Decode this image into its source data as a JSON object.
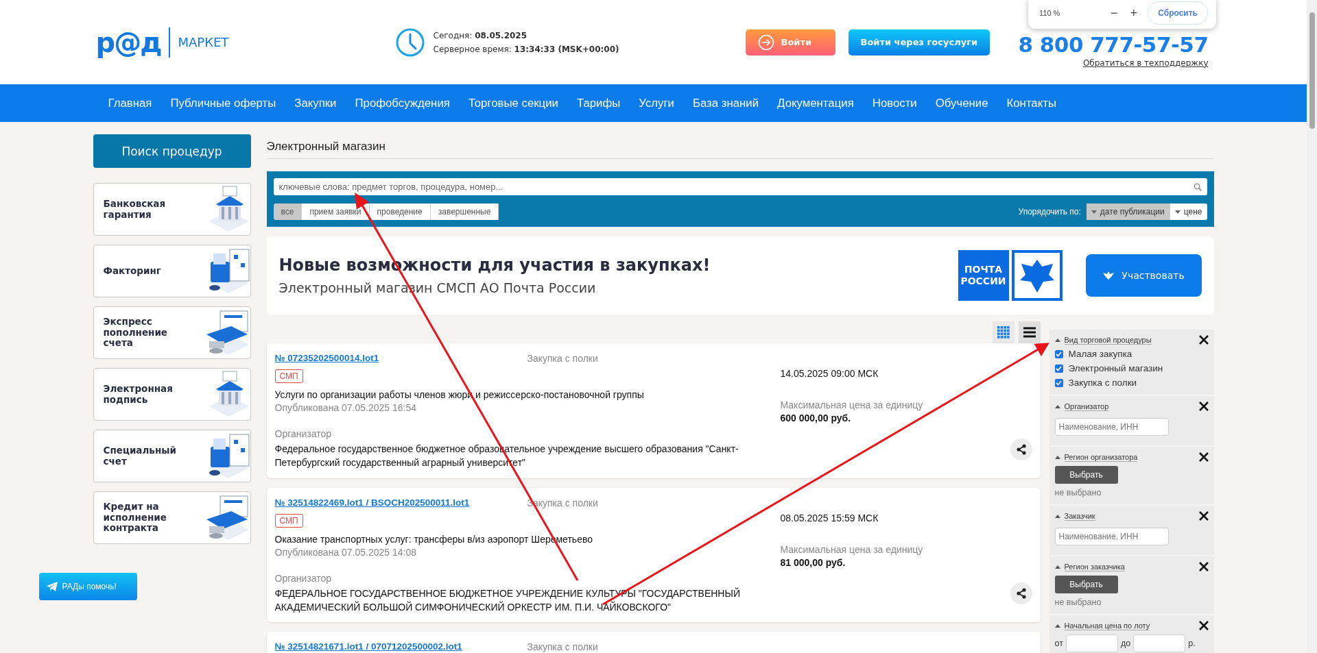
{
  "header": {
    "logo": {
      "mark": "р@д",
      "text": "МАРКЕТ"
    },
    "today_label": "Сегодня:",
    "today_value": "08.05.2025",
    "server_label": "Серверное время:",
    "server_value": "13:34:33 (MSK+00:00)",
    "login_button": "Войти",
    "gosuslugi_button": "Войти через госуслуги",
    "phone": "8 800 777-57-57",
    "support_link": "Обратиться в техподдержку"
  },
  "zoom_popup": {
    "level": "110 %",
    "minus": "−",
    "plus": "+",
    "reset": "Сбросить"
  },
  "nav": [
    "Главная",
    "Публичные оферты",
    "Закупки",
    "Профобсуждения",
    "Торговые секции",
    "Тарифы",
    "Услуги",
    "База знаний",
    "Документация",
    "Новости",
    "Обучение",
    "Контакты"
  ],
  "sidebar": {
    "search_button": "Поиск процедур",
    "services": [
      "Банковская гарантия",
      "Факторинг",
      "Экспресс пополнение счета",
      "Электронная подпись",
      "Специальный счет",
      "Кредит на исполнение контракта"
    ],
    "help_button": "РАДы помочь!"
  },
  "page_title": "Электронный магазин",
  "search": {
    "placeholder": "ключевые слова: предмет торгов, процедура, номер...",
    "tabs": [
      {
        "label": "все",
        "selected": true
      },
      {
        "label": "прием заявки",
        "selected": false
      },
      {
        "label": "проведение",
        "selected": false
      },
      {
        "label": "завершенные",
        "selected": false
      }
    ],
    "sort_label": "Упорядочить по:",
    "sort": [
      {
        "label": "дате публикации",
        "selected": true
      },
      {
        "label": "цене",
        "selected": false
      }
    ]
  },
  "banner": {
    "title": "Новые возможности для участия в закупках!",
    "subtitle": "Электронный магазин СМСП АО Почта России",
    "logo_text": [
      "ПОЧТА",
      "РОССИИ"
    ],
    "button": "Участвовать"
  },
  "view_toggle": [
    {
      "kind": "grid",
      "selected": false
    },
    {
      "kind": "list",
      "selected": true
    }
  ],
  "lots": [
    {
      "number": "№ 07235202500014.lot1",
      "type": "Закупка с полки",
      "badge": "СМП",
      "title": "Услуги по организации работы членов жюри и режиссерско-постановочной группы",
      "published": "Опубликована 07.05.2025 16:54",
      "organizer_label": "Организатор",
      "organizer": "Федеральное государственное бюджетное образовательное учреждение высшего образования \"Санкт-Петербургский государственный аграрный университет\"",
      "deadline": "14.05.2025 09:00 МСК",
      "price_label": "Максимальная цена за единицу",
      "price": "600 000,00 руб."
    },
    {
      "number": "№ 32514822469.lot1 / BSOCH202500011.lot1",
      "type": "Закупка с полки",
      "badge": "СМП",
      "title": "Оказание транспортных услуг: трансферы в/из аэропорт Шереметьево",
      "published": "Опубликована 07.05.2025 14:08",
      "organizer_label": "Организатор",
      "organizer": "ФЕДЕРАЛЬНОЕ ГОСУДАРСТВЕННОЕ БЮДЖЕТНОЕ УЧРЕЖДЕНИЕ КУЛЬТУРЫ \"ГОСУДАРСТВЕННЫЙ АКАДЕМИЧЕСКИЙ БОЛЬШОЙ СИМФОНИЧЕСКИЙ ОРКЕСТР ИМ. П.И. ЧАЙКОВСКОГО\"",
      "deadline": "08.05.2025 15:59 МСК",
      "price_label": "Максимальная цена за единицу",
      "price": "81 000,00 руб."
    },
    {
      "number": "№ 32514821671.lot1 / 07071202500002.lot1",
      "type": "Закупка с полки"
    }
  ],
  "filters": [
    {
      "kind": "checks",
      "title": "Вид торговой процедуры",
      "options": [
        {
          "label": "Малая закупка",
          "checked": true
        },
        {
          "label": "Электронный магазин",
          "checked": true
        },
        {
          "label": "Закупка с полки",
          "checked": true
        }
      ]
    },
    {
      "kind": "text",
      "title": "Организатор",
      "placeholder": "Наименование, ИНН"
    },
    {
      "kind": "select",
      "title": "Регион организатора",
      "button": "Выбрать",
      "value": "не выбрано"
    },
    {
      "kind": "text",
      "title": "Заказчик",
      "placeholder": "Наименование, ИНН"
    },
    {
      "kind": "select",
      "title": "Регион заказчика",
      "button": "Выбрать",
      "value": "не выбрано"
    },
    {
      "kind": "range",
      "title": "Начальная цена по лоту",
      "from": "от",
      "to": "до",
      "unit": "р."
    }
  ]
}
